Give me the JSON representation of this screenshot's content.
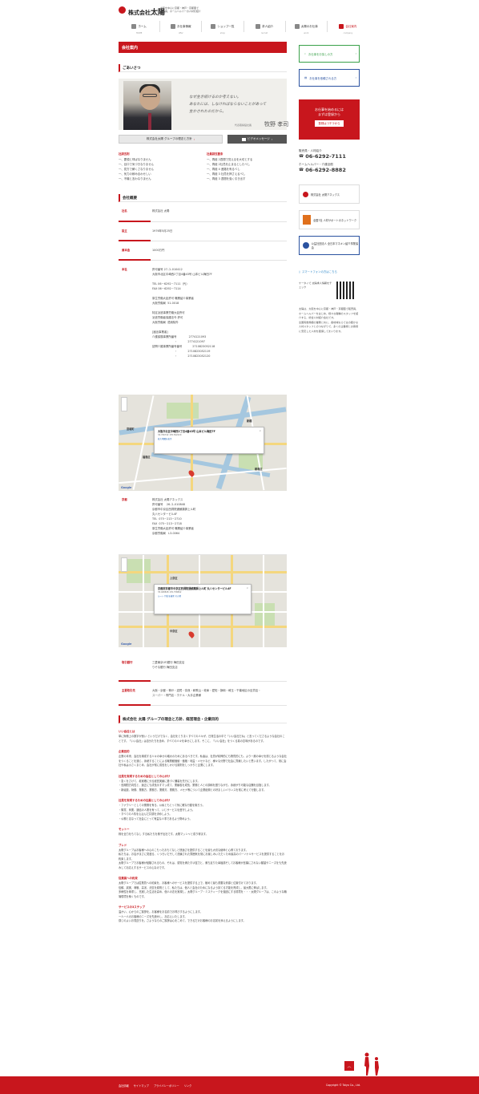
{
  "header": {
    "logo_prefix": "株式会社",
    "logo_main": "太陽",
    "tagline_lines": [
      "大阪を中心に京都・神戸・京都圏で",
      "販売員、ホームヘルパーの人材を紹介"
    ]
  },
  "gnav": [
    {
      "label": "ホーム",
      "sub": "HOME",
      "active": false
    },
    {
      "label": "お仕事情報",
      "sub": "offer",
      "active": false
    },
    {
      "label": "ショップ一覧",
      "sub": "shop",
      "active": false
    },
    {
      "label": "求人紹介",
      "sub": "recruit",
      "active": false
    },
    {
      "label": "太陽のお仕事",
      "sub": "work",
      "active": false
    },
    {
      "label": "会社案内",
      "sub": "company",
      "active": true
    }
  ],
  "main": {
    "page_title": "会社案内",
    "greeting": {
      "section_title": "ごあいさつ",
      "message": [
        "なぜ生き続けるのか考えない。",
        "あなたには、しなければならないことがあって",
        "生かされたのだから。"
      ],
      "ceo_title": "代表取締役社長",
      "ceo_name": "牧野 孝司",
      "btn_philosophy": "株式会社太陽 グループの理念と方針",
      "btn_video": "ビデオメッセージ"
    },
    "pledge": {
      "left_head": "社訓五則",
      "left_items": [
        "一、要領と呼ばなりません",
        "一、目口で気づきなりません",
        "一、見方で解くさなりません",
        "一、気力の積み合わせしい",
        "一、不機と言わなりません"
      ],
      "right_head": "社員訓五箇条",
      "right_items": [
        "一、再経 2週間で覚えるを大切とする",
        "一、再経 2社員を止まるとしたべし",
        "一、再経 4 進路を有るべし",
        "一、再経 3 社員を押さえるべし",
        "一、再経 3 週間を強く引き出す"
      ]
    },
    "overview": {
      "section_title": "会社概要",
      "rows": [
        {
          "head": "社名",
          "value": "株式会社 太陽"
        },
        {
          "head": "設立",
          "value": "1976年5月25日"
        },
        {
          "head": "資本金",
          "value": "1000万円"
        },
        {
          "head": "本社",
          "value": "許可番号 27-ユ-010412\n大阪市北区中崎西2丁目4番43号 山本ビル梅田7F\n\nTEL 06－6292－7111（代）\nFAX 06－6292－7114\n\n厚生労働大臣許可 職業紹介事業者\n大阪労働局  51-0018\n\n特定派遣事業労働大臣許可\n派遣労働者保護法令 許可\n大阪労働局  適用除外\n\n[届出事業者]\n介護保険事業所番号              2774121093\n                          ・            2774121097\n訪問介護事業所番号番号            2710823052118\n                          ・            2710823052119\n                          ・            2710823052120"
        },
        {
          "head": "京都",
          "value": "株式会社 太陽アネックス\n許可番号    26-ユ-010848\n京都市中京区西洞院通蛸薬師上ル町\n丸八センタービル4F\nTEL  075－213－2710\nFAX  075－213－2718\n厚生労働大臣許可 職業紹介事業者\n京都労働局   L3-0064"
        },
        {
          "head": "取引銀行",
          "value": "三菱東京UFJ銀行 梅田支店\nりそな銀行 梅田支店"
        },
        {
          "head": "主要取引先",
          "value": "大阪・京都・神戸・滋賀・奈良・和歌山・岐阜・愛知・静岡・埼玉・千葉地区の百貨店・\nスーパー・専門店・ホテル・大手企業様"
        }
      ]
    },
    "map_osaka": {
      "address": "大阪市北区中崎西2丁目4番43号 山本ビル梅田7F",
      "coords": "34.706742 135.502220",
      "links": "拡大地図を表示",
      "labels": [
        "宮城町",
        "福島区",
        "新橋",
        "都島区"
      ]
    },
    "map_kyoto": {
      "address": "京都府京都市中京区西洞院通蛸薬師上ル町 丸八センタービル4F",
      "coords": "35.008828 135.758892",
      "links": "ルート  付近を検索  その他",
      "labels": [
        "上京区",
        "中京区"
      ]
    },
    "philosophy": {
      "title": "株式会社 太陽 グループの理念と方針、経営理念・企業目的",
      "blocks": [
        {
          "head": "いい会社とは",
          "text": "単に財務上の数字が良い というだけでなく、会社をとりまくすべての人々が、日常生活の中で「いい会社だね」と言ってくださるような会社のことです。「いい会社」は自分たちを含め、すべての人々を幸せにします。そこに、「いい会社」をつくる真の意味があるのです。"
        },
        {
          "head": "企業目的",
          "text": "企業の本来、会社を構成する人々の幸せの増大のためにあるべきです。私達は、社員が精神的にも物質的にも、より一層の幸せを感じるような会社をつくることを通じ、永続することによる職業観価値・価格・利益・メセナなど、様々な分野で社会に貢献したいと思います。したがって、常に会社や私は小さくまとめ、会社が常に成長をしかける原則をしっかりと企業にします。"
        },
        {
          "head": "社是を実現するための会社としての心がけ",
          "text": "・急くをさけて、着実確に分る経営実績に基づく舗装を先行にします。\n・長期間方向性と、適正にも成長示すマッ成て、業績各を成長、業務と人との調和を図りながら、永続がり可能な店舗を目指します。\n・新組技、財務、業務方、業務方、業務方、業務方、メセナ等について企業経費との好ましいバランスを常に考えて行動します。"
        },
        {
          "head": "社是を実現するための社員としての心がけ",
          "text": "・ファウリーとしての業務を有る、公私ともとって気に確な行動を取ろう。\n・購買、商業、通信の人業を有って、いじサービスを遵守しよう。\n・すべての人情を心込んだ共感を決めしよう。\n・公務と名なって社会にとって有益な人事であるよう努めよう。"
        },
        {
          "head": "モットー",
          "text": "株を全力をもてなし する私たちを株子出社です。太陽マッシャと成り得ます。"
        },
        {
          "head": "ブレド",
          "text": "太陽グループはお客様への心のこもったおもてなしと快適さを提供することを最も大切な使命と心得ております。\n私たちは、お店がまさに見渡る、くつろいだそして洗練された雰囲気を常にお楽しみいただくため最高のパーソナルサービスを提供することをお約束します。\n太陽グループでお客様が経験されるもの、それは、感覚を満たすゆ賞力と、満ち足りた幸福感そしてお客様が言葉にされない願望やニーズをも先読みしてお応えするサービスの心なのです。"
        },
        {
          "head": "従業員への約束",
          "text": "太陽グループでは従業員への約束を、お客様へのサービスを提供する上で、極めて最も重要な資源と位置付けております。\n信頼、誠実、尊敬、高潔、決意を原則として、私たちは、個人と会社のためになるよう持てる才能を育成し、最大限に伸ばします。\n多様性を尊重し、充実した生活を高め、個人の志を実現し、太陽グループ・ミスティークを強固にする環境を・・・太陽グループは、このような職場環境を築くものです。"
        },
        {
          "head": "サービスの3ステップ",
          "text": "温かい、心からのご挨拶を。お客様をお名前でお呼びするようにします。\n一人一人のお客様のニーズを先読みし、お応えいたします。\n感じのよいお見送りを。さようならのご挨拶は心をこめて、できるだけお客様のお名前を添えるようにします。"
        }
      ]
    }
  },
  "sidebar": {
    "btn_search": "お仕事をお探しの方",
    "btn_register": "お仕事を依頼される方",
    "cta_lines": [
      "お仕事を始めるには",
      "まずは登録から"
    ],
    "cta_pill": "登録はコチラから",
    "tel1_label": "販売員・人材紹介",
    "tel1_num": "06-6292-7111",
    "tel2_label": "ホームヘルパー・介護全般",
    "tel2_num": "06-6292-8882",
    "banners": [
      {
        "label": "株式会社 太陽アネックス",
        "color": "#c8161d"
      },
      {
        "label": "全国7社 人材サポートのネットワーク",
        "color": "#e0701c"
      },
      {
        "label": "公益社団法人 全日本マネキン紹介事業協会",
        "color": "#2a52a0"
      }
    ],
    "smartphone_label": "スマートフォンの方はこちら",
    "qr_caption": "ケータイで 太陽求人情報をチェック",
    "description": "太陽は、大阪を中心に京都・神戸・京都圏で販売員、ホームヘルパーをはじめ、様々な職種のスタッフを紹介する、総合人材紹介会社です。\n全国有数規模の業務と共に、各地域ならではの確かな人材スタッフとのつながりで、多くの企業様とお客様に安定した人材を確保してまいります。"
  },
  "footer": {
    "links": [
      "会社情報",
      "サイトマップ",
      "プライバシーポリシー",
      "リンク"
    ],
    "copyright": "Copyright © Taiyo Co., Ltd."
  },
  "colors": {
    "brand": "#c8161d",
    "green": "#3aa14a",
    "blue": "#2a52a0"
  }
}
